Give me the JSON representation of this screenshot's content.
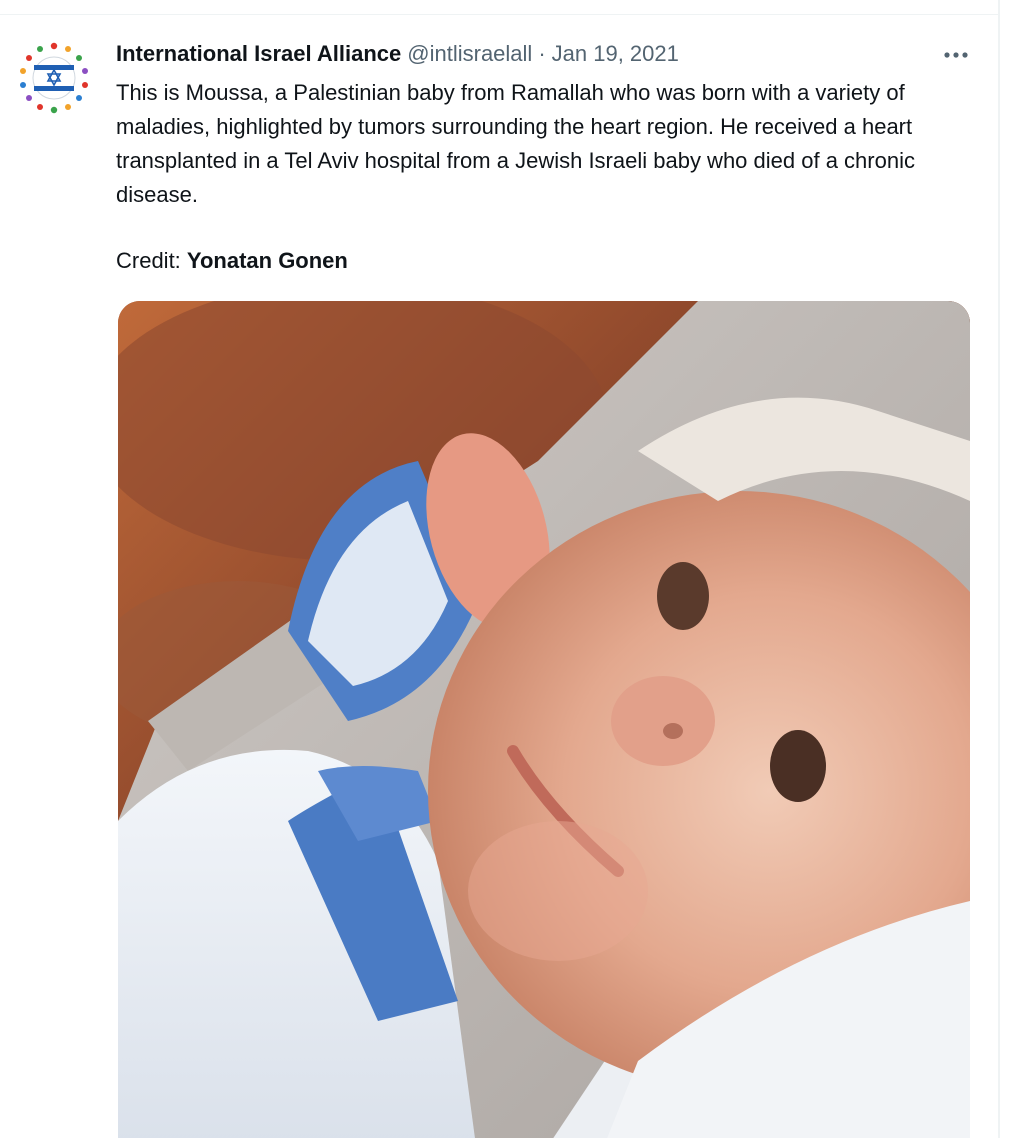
{
  "tweet": {
    "author": {
      "display_name": "International Israel Alliance",
      "handle": "@intlisraelall",
      "avatar_icon": "israel-flag-stars-logo"
    },
    "separator": "·",
    "date": "Jan 19, 2021",
    "more_icon": "more-dots-icon",
    "text": "This is Moussa, a Palestinian baby from Ramallah who was born with a variety of maladies, highlighted by tumors surrounding the heart region. He received a heart transplanted in a Tel Aviv hospital from a Jewish Israeli baby who died of a chronic disease.",
    "credit_label": "Credit: ",
    "credit_name": "Yonatan Gonen",
    "media": {
      "type": "photo",
      "subject": "baby-photo"
    }
  },
  "colors": {
    "text_primary": "#0f1419",
    "text_secondary": "#536471",
    "divider": "#eff3f4",
    "flag_blue": "#1f5fb3"
  }
}
